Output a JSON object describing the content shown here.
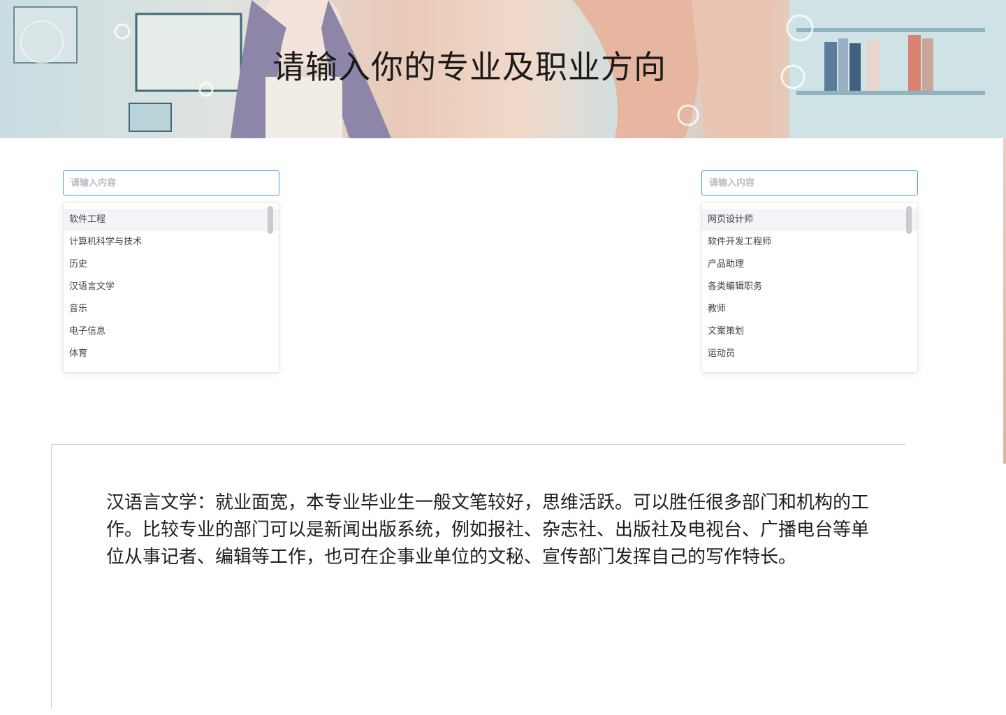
{
  "header": {
    "title": "请输入你的专业及职业方向"
  },
  "left_panel": {
    "search_placeholder": "请输入内容",
    "items": [
      "软件工程",
      "计算机科学与技术",
      "历史",
      "汉语言文学",
      "音乐",
      "电子信息",
      "体育"
    ]
  },
  "right_panel": {
    "search_placeholder": "请输入内容",
    "items": [
      "网页设计师",
      "软件开发工程师",
      "产品助理",
      "各类编辑职务",
      "教师",
      "文案策划",
      "运动员"
    ]
  },
  "description": {
    "text": "汉语言文学：就业面宽，本专业毕业生一般文笔较好，思维活跃。可以胜任很多部门和机构的工作。比较专业的部门可以是新闻出版系统，例如报社、杂志社、出版社及电视台、广播电台等单位从事记者、编辑等工作，也可在企事业单位的文秘、宣传部门发挥自己的写作特长。"
  },
  "colors": {
    "input_border": "#409eff",
    "highlight_row": "#f2f4f7"
  }
}
